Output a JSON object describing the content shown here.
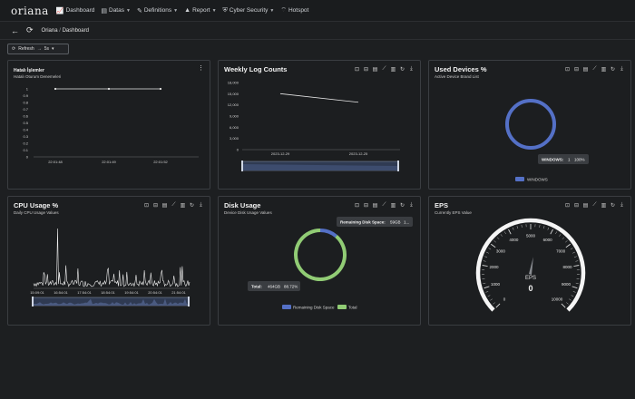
{
  "nav": {
    "brand": "oriana",
    "items": [
      {
        "icon": "📈",
        "label": "Dashboard",
        "caret": false
      },
      {
        "icon": "▤",
        "label": "Datas",
        "caret": true
      },
      {
        "icon": "✎",
        "label": "Definitions",
        "caret": true
      },
      {
        "icon": "▲",
        "label": "Report",
        "caret": true
      },
      {
        "icon": "⛨",
        "label": "Cyber Security",
        "caret": true
      },
      {
        "icon": "⌔",
        "label": "Hotspot",
        "caret": false
      }
    ]
  },
  "breadcrumb": {
    "root": "Oriana",
    "separator": " / ",
    "page": "Dashboard"
  },
  "refresh": {
    "label": "Refresh",
    "arrow": "→",
    "interval": "5s"
  },
  "cards": {
    "errors": {
      "title": "Hatalı İşlemler",
      "subtitle": "Hatalı Oturum Denemeleri"
    },
    "weekly": {
      "title": "Weekly Log Counts"
    },
    "devices": {
      "title": "Used Devices %",
      "subtitle": "Active Device Brand List",
      "tooltip_name": "WINDOWS:",
      "tooltip_count": "1",
      "tooltip_pct": "100%",
      "legend": "WINDOWS"
    },
    "cpu": {
      "title": "CPU Usage %",
      "subtitle": "Daily CPU Usage Values"
    },
    "disk": {
      "title": "Disk Usage",
      "subtitle": "Device Disk Usage Values",
      "tooltip_label": "Remaining Disk Space:",
      "tooltip_value": "59GB",
      "tooltip_more": "1...",
      "total_label": "Total:",
      "total_value": "464GB",
      "total_pct": "88.72%",
      "legend_a": "Remaining Disk Space",
      "legend_b": "Total"
    },
    "eps": {
      "title": "EPS",
      "subtitle": "Currently EPS Value",
      "gauge_label": "EPS",
      "gauge_value": "0"
    }
  },
  "colors": {
    "accent_blue": "#5470c6",
    "accent_green": "#91cc75",
    "bg": "#1d1f21"
  },
  "chart_data": [
    {
      "type": "line",
      "title": "Hatalı İşlemler",
      "categories": [
        "22:01:48",
        "22:01:49",
        "22:01:52"
      ],
      "values": [
        1,
        1,
        1
      ],
      "yticks": [
        "1",
        "0.9",
        "0.8",
        "0.7",
        "0.6",
        "0.5",
        "0.4",
        "0.3",
        "0.2",
        "0.1",
        "0"
      ],
      "ylim": [
        0,
        1
      ]
    },
    {
      "type": "line",
      "title": "Weekly Log Counts",
      "x": [
        "2023-12-29",
        "2023-12-25"
      ],
      "values": [
        15000,
        12700
      ],
      "yticks": [
        "18,000",
        "15,000",
        "12,000",
        "9,000",
        "6,000",
        "3,000",
        "0"
      ],
      "ylim": [
        0,
        18000
      ]
    },
    {
      "type": "pie",
      "title": "Used Devices %",
      "series": [
        {
          "name": "WINDOWS",
          "values": [
            1
          ]
        }
      ]
    },
    {
      "type": "line",
      "title": "CPU Usage %",
      "xticks": [
        "15:09:01",
        "16:54:01",
        "17:54:01",
        "18:54:01",
        "19:54:01",
        "20:54:01",
        "21:54:01"
      ],
      "series_note": "spiky daily series"
    },
    {
      "type": "pie",
      "title": "Disk Usage",
      "series": [
        {
          "name": "Remaining Disk Space",
          "values": [
            59
          ]
        },
        {
          "name": "Total",
          "values": [
            464
          ]
        }
      ]
    },
    {
      "type": "gauge",
      "title": "EPS",
      "ticks": [
        "0",
        "1000",
        "2000",
        "3000",
        "4000",
        "5000",
        "6000",
        "7000",
        "8000",
        "9000",
        "10000"
      ],
      "value": 0,
      "range": [
        0,
        10000
      ]
    }
  ]
}
